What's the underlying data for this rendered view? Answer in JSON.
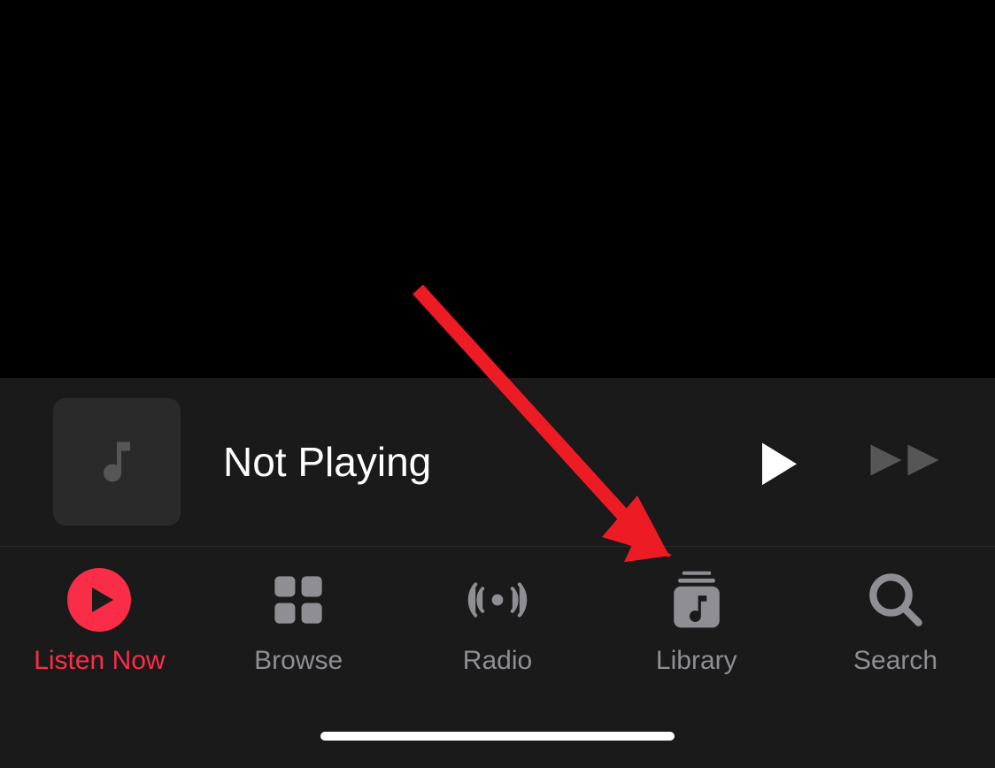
{
  "nowPlaying": {
    "status": "Not Playing"
  },
  "tabs": {
    "listenNow": "Listen Now",
    "browse": "Browse",
    "radio": "Radio",
    "library": "Library",
    "search": "Search"
  },
  "colors": {
    "accent": "#fa2d48",
    "annotation": "#ed1c24"
  }
}
